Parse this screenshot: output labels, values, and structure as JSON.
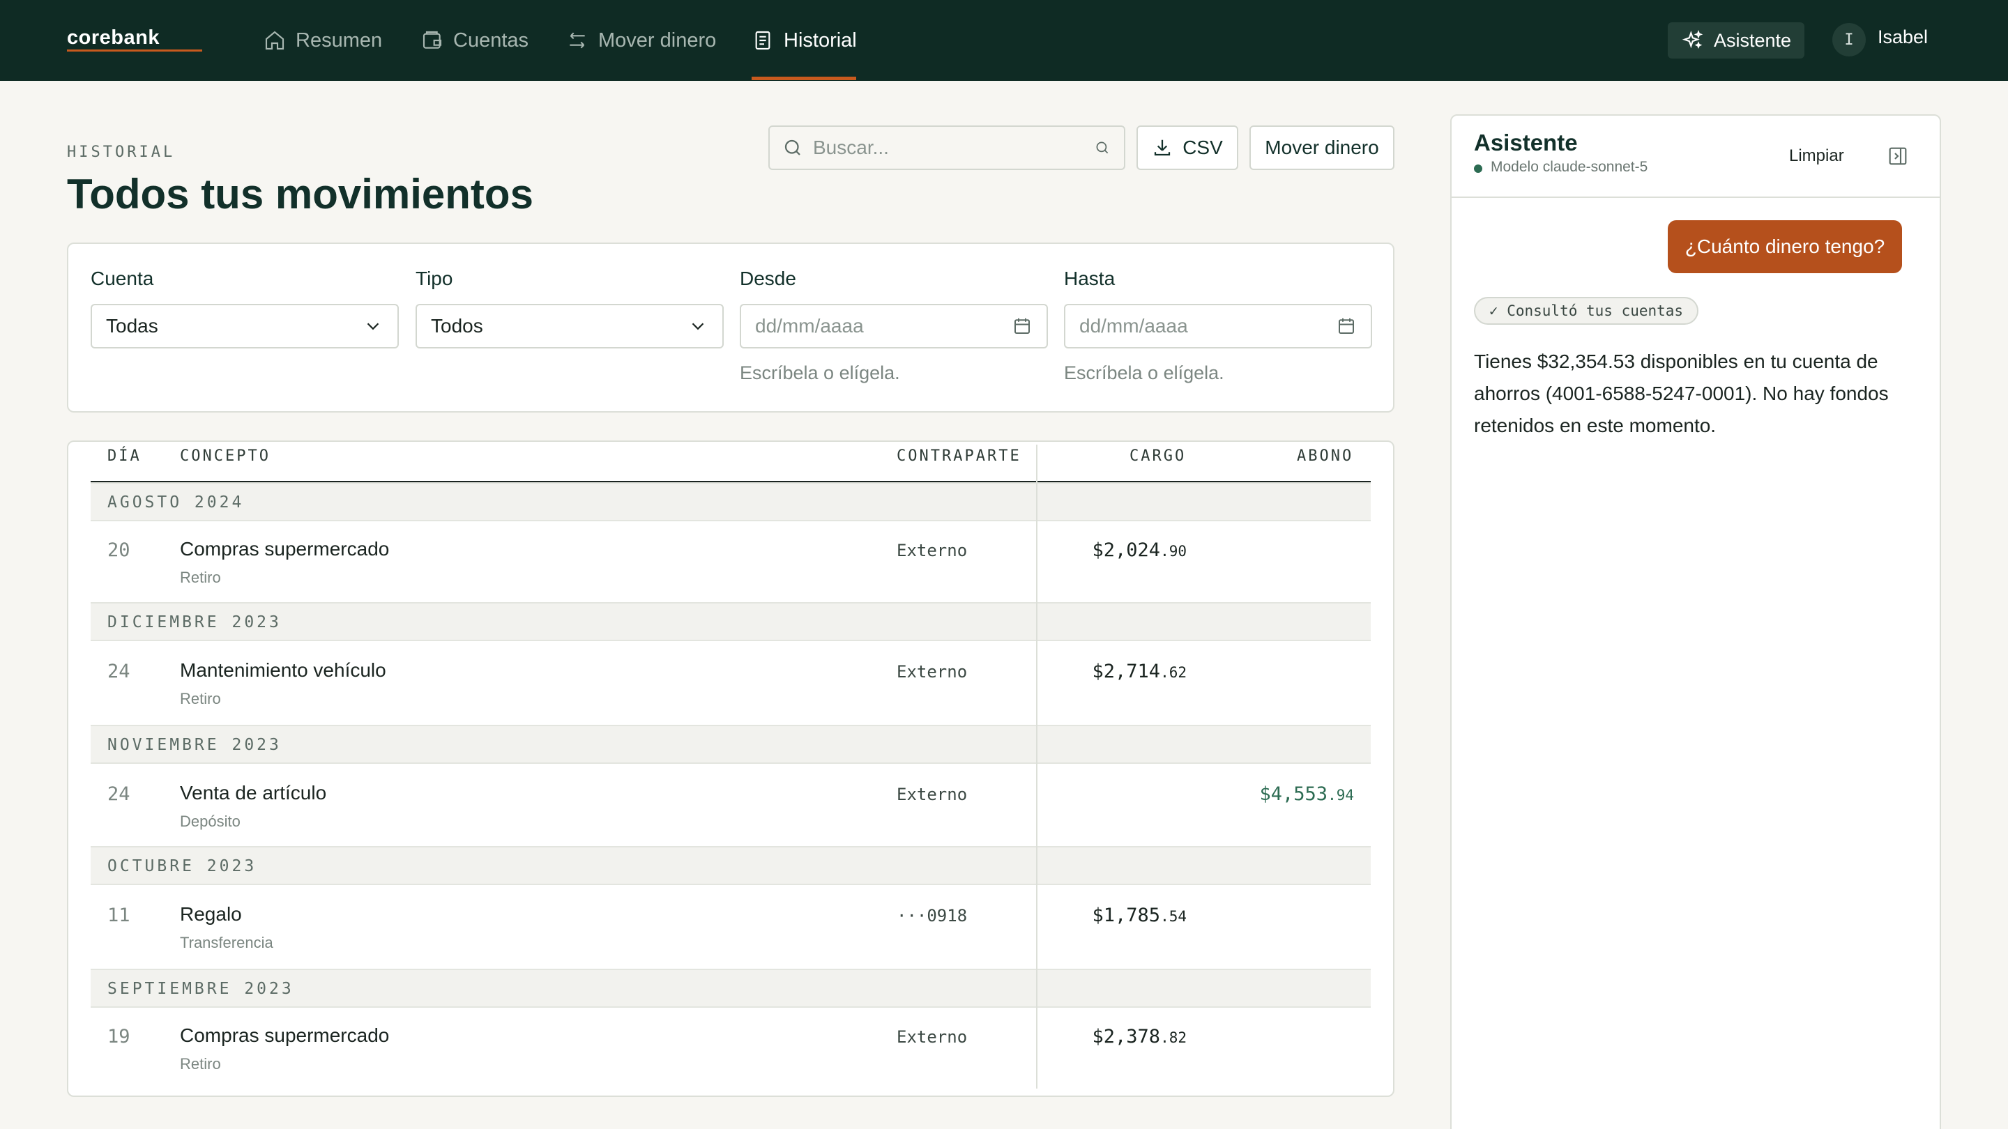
{
  "brand": {
    "logo": "corebank",
    "accent_color": "#c85a1e",
    "nav_bg": "#0f2b24"
  },
  "nav": {
    "items": [
      {
        "label": "Resumen",
        "icon": "home-icon",
        "active": false
      },
      {
        "label": "Cuentas",
        "icon": "wallet-icon",
        "active": false
      },
      {
        "label": "Mover dinero",
        "icon": "transfer-icon",
        "active": false
      },
      {
        "label": "Historial",
        "icon": "document-icon",
        "active": true
      }
    ],
    "assistant_label": "Asistente",
    "user_initial": "I",
    "user_name": "Isabel"
  },
  "page": {
    "eyebrow": "HISTORIAL",
    "title": "Todos tus movimientos"
  },
  "toolbar": {
    "search_placeholder": "Buscar...",
    "csv_label": "CSV",
    "move_label": "Mover dinero"
  },
  "filters": {
    "cuenta": {
      "label": "Cuenta",
      "value": "Todas"
    },
    "tipo": {
      "label": "Tipo",
      "value": "Todos"
    },
    "desde": {
      "label": "Desde",
      "placeholder": "dd/mm/aaaa",
      "hint": "Escríbela o elígela."
    },
    "hasta": {
      "label": "Hasta",
      "placeholder": "dd/mm/aaaa",
      "hint": "Escríbela o elígela."
    }
  },
  "table": {
    "headers": {
      "day": "DÍA",
      "concept": "CONCEPTO",
      "counterparty": "CONTRAPARTE",
      "charge": "CARGO",
      "credit": "ABONO"
    },
    "groups": [
      {
        "month": "AGOSTO 2024",
        "rows": [
          {
            "day": "20",
            "concept": "Compras supermercado",
            "type": "Retiro",
            "counterparty": "Externo",
            "charge_main": "$2,024",
            "charge_cents": ".90",
            "credit_main": "",
            "credit_cents": ""
          }
        ]
      },
      {
        "month": "DICIEMBRE 2023",
        "rows": [
          {
            "day": "24",
            "concept": "Mantenimiento vehículo",
            "type": "Retiro",
            "counterparty": "Externo",
            "charge_main": "$2,714",
            "charge_cents": ".62",
            "credit_main": "",
            "credit_cents": ""
          }
        ]
      },
      {
        "month": "NOVIEMBRE 2023",
        "rows": [
          {
            "day": "24",
            "concept": "Venta de artículo",
            "type": "Depósito",
            "counterparty": "Externo",
            "charge_main": "",
            "charge_cents": "",
            "credit_main": "$4,553",
            "credit_cents": ".94"
          }
        ]
      },
      {
        "month": "OCTUBRE 2023",
        "rows": [
          {
            "day": "11",
            "concept": "Regalo",
            "type": "Transferencia",
            "counterparty": "···0918",
            "charge_main": "$1,785",
            "charge_cents": ".54",
            "credit_main": "",
            "credit_cents": ""
          }
        ]
      },
      {
        "month": "SEPTIEMBRE 2023",
        "rows": [
          {
            "day": "19",
            "concept": "Compras supermercado",
            "type": "Retiro",
            "counterparty": "Externo",
            "charge_main": "$2,378",
            "charge_cents": ".82",
            "credit_main": "",
            "credit_cents": ""
          }
        ]
      }
    ]
  },
  "assistant": {
    "title": "Asistente",
    "model": "Modelo claude-sonnet-5",
    "clear_label": "Limpiar",
    "user_message": "¿Cuánto dinero tengo?",
    "tool_chip": "✓ Consultó tus cuentas",
    "answer": "Tienes $32,354.53 disponibles en tu cuenta de ahorros (4001-6588-5247-0001). No hay fondos retenidos en este momento."
  }
}
